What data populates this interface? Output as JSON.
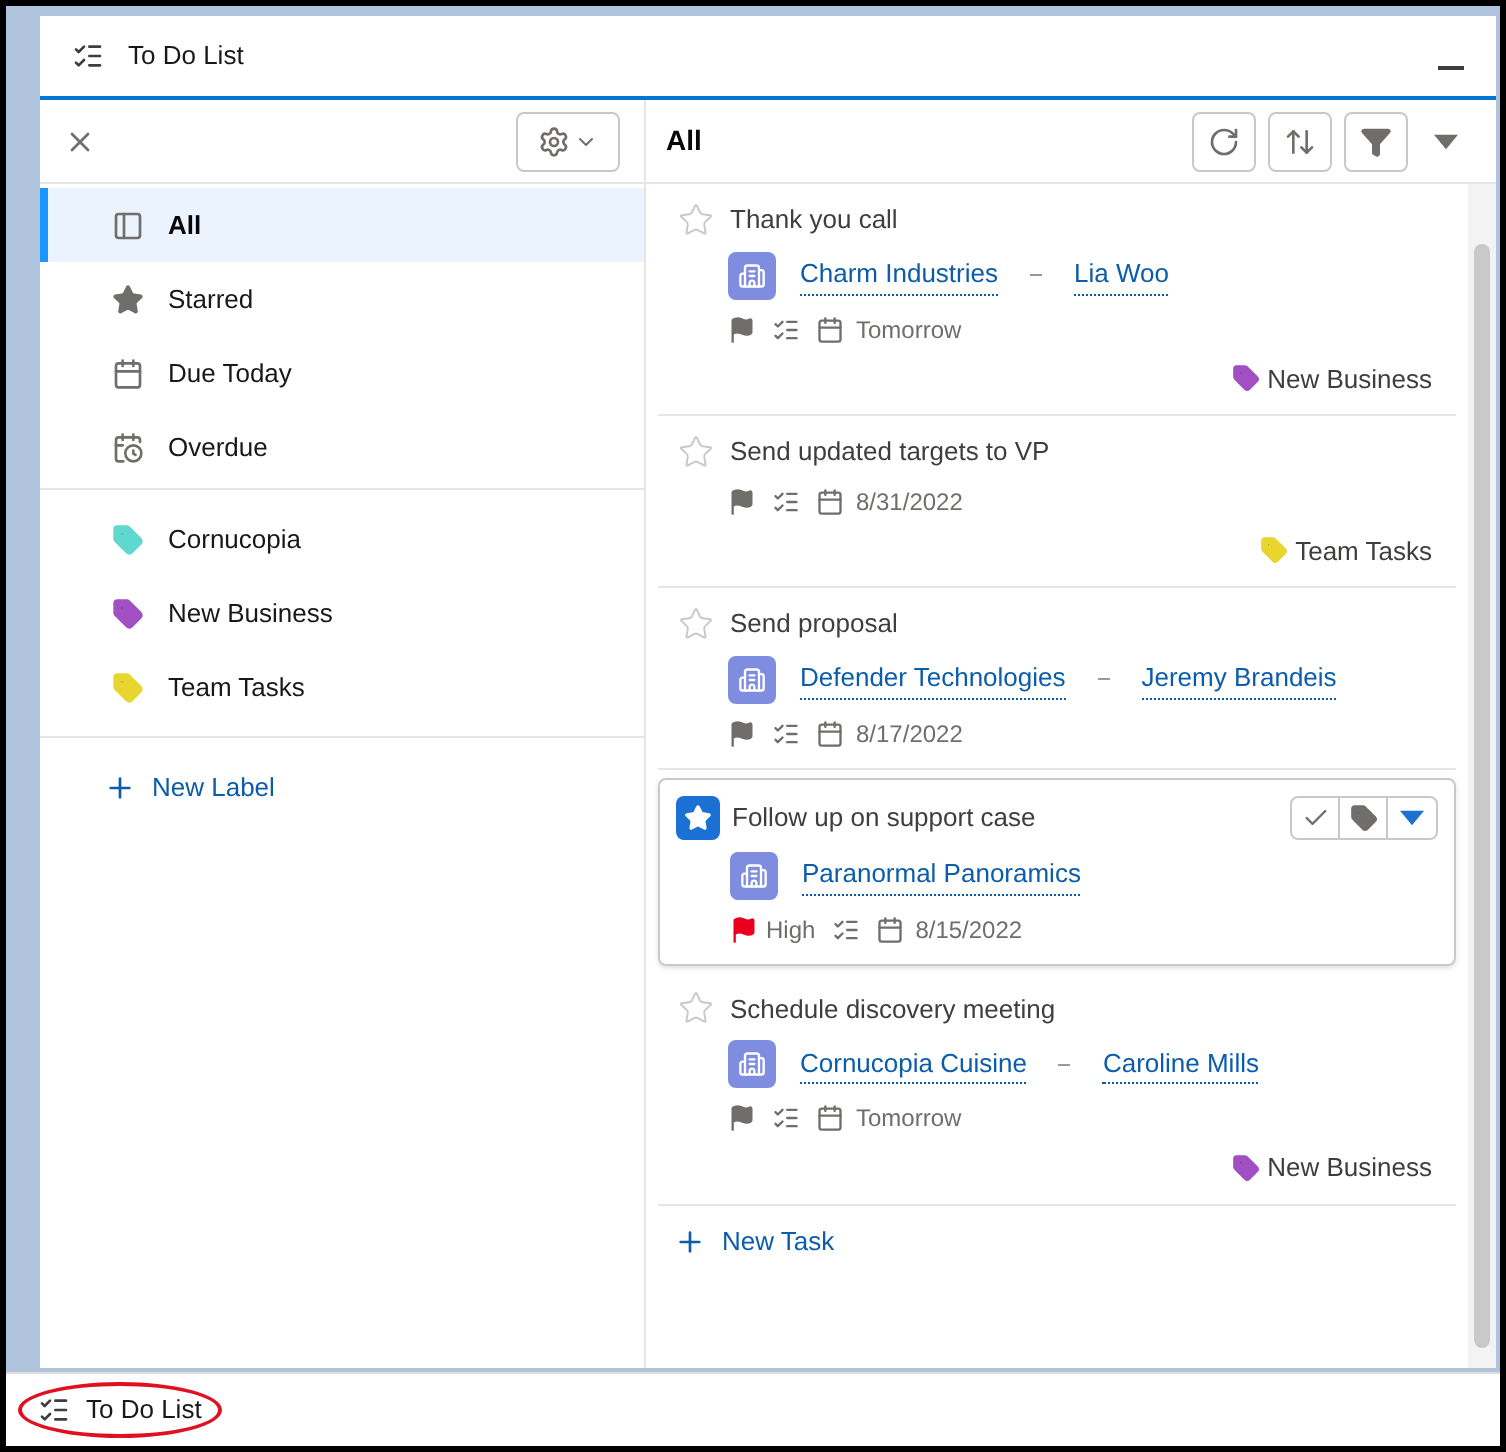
{
  "window": {
    "title": "To Do List"
  },
  "sidebar": {
    "items": [
      {
        "kind": "view",
        "label": "All",
        "selected": true
      },
      {
        "kind": "view",
        "label": "Starred",
        "selected": false
      },
      {
        "kind": "view",
        "label": "Due Today",
        "selected": false
      },
      {
        "kind": "view",
        "label": "Overdue",
        "selected": false
      },
      {
        "kind": "label",
        "label": "Cornucopia",
        "color": "#5fd8d0",
        "selected": false
      },
      {
        "kind": "label",
        "label": "New Business",
        "color": "#a24fc4",
        "selected": false
      },
      {
        "kind": "label",
        "label": "Team Tasks",
        "color": "#e8d530",
        "selected": false
      }
    ],
    "new_label": "New Label"
  },
  "list": {
    "title": "All",
    "tasks": [
      {
        "title": "Thank you call",
        "starred": false,
        "selected": false,
        "account": "Charm Industries",
        "contact": "Lia Woo",
        "due": "Tomorrow",
        "label": {
          "name": "New Business",
          "color": "#a24fc4"
        }
      },
      {
        "title": "Send updated targets to VP",
        "starred": false,
        "selected": false,
        "due": "8/31/2022",
        "label": {
          "name": "Team Tasks",
          "color": "#e8d530"
        }
      },
      {
        "title": "Send proposal",
        "starred": false,
        "selected": false,
        "account": "Defender Technologies",
        "contact": "Jeremy Brandeis",
        "due": "8/17/2022"
      },
      {
        "title": "Follow up on support case",
        "starred": true,
        "selected": true,
        "account": "Paranormal Panoramics",
        "priority": "High",
        "due": "8/15/2022"
      },
      {
        "title": "Schedule discovery meeting",
        "starred": false,
        "selected": false,
        "account": "Cornucopia Cuisine",
        "contact": "Caroline Mills",
        "due": "Tomorrow",
        "label": {
          "name": "New Business",
          "color": "#a24fc4"
        }
      }
    ],
    "new_task": "New Task"
  },
  "taskbar": {
    "button": "To Do List"
  }
}
